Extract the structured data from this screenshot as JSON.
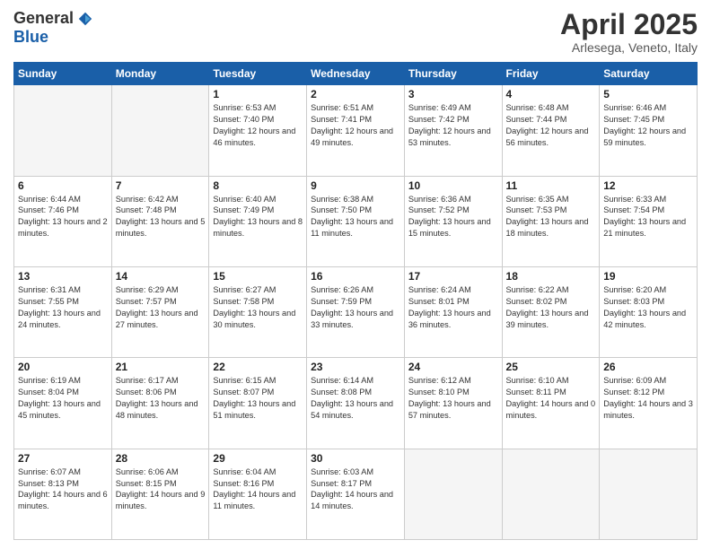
{
  "header": {
    "logo_general": "General",
    "logo_blue": "Blue",
    "title": "April 2025",
    "location": "Arlesega, Veneto, Italy"
  },
  "days_of_week": [
    "Sunday",
    "Monday",
    "Tuesday",
    "Wednesday",
    "Thursday",
    "Friday",
    "Saturday"
  ],
  "weeks": [
    [
      {
        "day": "",
        "info": ""
      },
      {
        "day": "",
        "info": ""
      },
      {
        "day": "1",
        "info": "Sunrise: 6:53 AM\nSunset: 7:40 PM\nDaylight: 12 hours and 46 minutes."
      },
      {
        "day": "2",
        "info": "Sunrise: 6:51 AM\nSunset: 7:41 PM\nDaylight: 12 hours and 49 minutes."
      },
      {
        "day": "3",
        "info": "Sunrise: 6:49 AM\nSunset: 7:42 PM\nDaylight: 12 hours and 53 minutes."
      },
      {
        "day": "4",
        "info": "Sunrise: 6:48 AM\nSunset: 7:44 PM\nDaylight: 12 hours and 56 minutes."
      },
      {
        "day": "5",
        "info": "Sunrise: 6:46 AM\nSunset: 7:45 PM\nDaylight: 12 hours and 59 minutes."
      }
    ],
    [
      {
        "day": "6",
        "info": "Sunrise: 6:44 AM\nSunset: 7:46 PM\nDaylight: 13 hours and 2 minutes."
      },
      {
        "day": "7",
        "info": "Sunrise: 6:42 AM\nSunset: 7:48 PM\nDaylight: 13 hours and 5 minutes."
      },
      {
        "day": "8",
        "info": "Sunrise: 6:40 AM\nSunset: 7:49 PM\nDaylight: 13 hours and 8 minutes."
      },
      {
        "day": "9",
        "info": "Sunrise: 6:38 AM\nSunset: 7:50 PM\nDaylight: 13 hours and 11 minutes."
      },
      {
        "day": "10",
        "info": "Sunrise: 6:36 AM\nSunset: 7:52 PM\nDaylight: 13 hours and 15 minutes."
      },
      {
        "day": "11",
        "info": "Sunrise: 6:35 AM\nSunset: 7:53 PM\nDaylight: 13 hours and 18 minutes."
      },
      {
        "day": "12",
        "info": "Sunrise: 6:33 AM\nSunset: 7:54 PM\nDaylight: 13 hours and 21 minutes."
      }
    ],
    [
      {
        "day": "13",
        "info": "Sunrise: 6:31 AM\nSunset: 7:55 PM\nDaylight: 13 hours and 24 minutes."
      },
      {
        "day": "14",
        "info": "Sunrise: 6:29 AM\nSunset: 7:57 PM\nDaylight: 13 hours and 27 minutes."
      },
      {
        "day": "15",
        "info": "Sunrise: 6:27 AM\nSunset: 7:58 PM\nDaylight: 13 hours and 30 minutes."
      },
      {
        "day": "16",
        "info": "Sunrise: 6:26 AM\nSunset: 7:59 PM\nDaylight: 13 hours and 33 minutes."
      },
      {
        "day": "17",
        "info": "Sunrise: 6:24 AM\nSunset: 8:01 PM\nDaylight: 13 hours and 36 minutes."
      },
      {
        "day": "18",
        "info": "Sunrise: 6:22 AM\nSunset: 8:02 PM\nDaylight: 13 hours and 39 minutes."
      },
      {
        "day": "19",
        "info": "Sunrise: 6:20 AM\nSunset: 8:03 PM\nDaylight: 13 hours and 42 minutes."
      }
    ],
    [
      {
        "day": "20",
        "info": "Sunrise: 6:19 AM\nSunset: 8:04 PM\nDaylight: 13 hours and 45 minutes."
      },
      {
        "day": "21",
        "info": "Sunrise: 6:17 AM\nSunset: 8:06 PM\nDaylight: 13 hours and 48 minutes."
      },
      {
        "day": "22",
        "info": "Sunrise: 6:15 AM\nSunset: 8:07 PM\nDaylight: 13 hours and 51 minutes."
      },
      {
        "day": "23",
        "info": "Sunrise: 6:14 AM\nSunset: 8:08 PM\nDaylight: 13 hours and 54 minutes."
      },
      {
        "day": "24",
        "info": "Sunrise: 6:12 AM\nSunset: 8:10 PM\nDaylight: 13 hours and 57 minutes."
      },
      {
        "day": "25",
        "info": "Sunrise: 6:10 AM\nSunset: 8:11 PM\nDaylight: 14 hours and 0 minutes."
      },
      {
        "day": "26",
        "info": "Sunrise: 6:09 AM\nSunset: 8:12 PM\nDaylight: 14 hours and 3 minutes."
      }
    ],
    [
      {
        "day": "27",
        "info": "Sunrise: 6:07 AM\nSunset: 8:13 PM\nDaylight: 14 hours and 6 minutes."
      },
      {
        "day": "28",
        "info": "Sunrise: 6:06 AM\nSunset: 8:15 PM\nDaylight: 14 hours and 9 minutes."
      },
      {
        "day": "29",
        "info": "Sunrise: 6:04 AM\nSunset: 8:16 PM\nDaylight: 14 hours and 11 minutes."
      },
      {
        "day": "30",
        "info": "Sunrise: 6:03 AM\nSunset: 8:17 PM\nDaylight: 14 hours and 14 minutes."
      },
      {
        "day": "",
        "info": ""
      },
      {
        "day": "",
        "info": ""
      },
      {
        "day": "",
        "info": ""
      }
    ]
  ]
}
